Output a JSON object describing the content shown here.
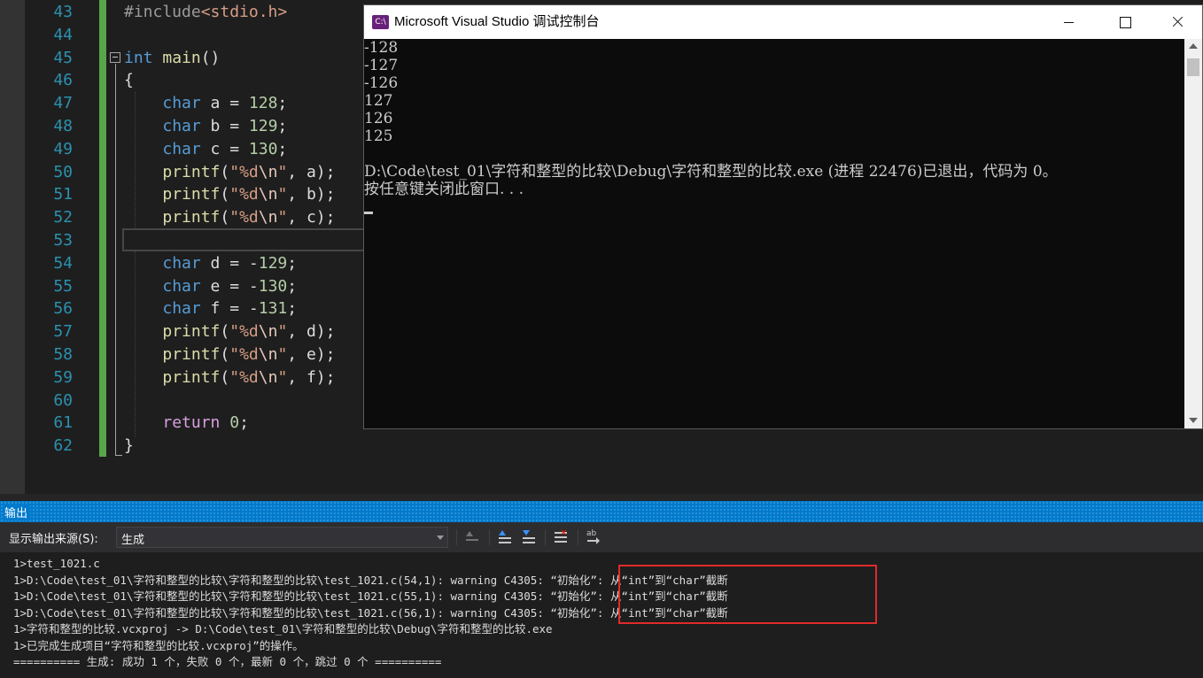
{
  "editor": {
    "lines": [
      {
        "n": "43",
        "segs": [
          [
            "pp",
            "#include"
          ],
          [
            "inc",
            "<stdio.h>"
          ]
        ]
      },
      {
        "n": "44",
        "segs": []
      },
      {
        "n": "45",
        "segs": [
          [
            "kw",
            "int"
          ],
          [
            "",
            " "
          ],
          [
            "fn",
            "main"
          ],
          [
            "",
            "()"
          ]
        ]
      },
      {
        "n": "46",
        "segs": [
          [
            "",
            "{"
          ]
        ]
      },
      {
        "n": "47",
        "segs": [
          [
            "",
            "    "
          ],
          [
            "kw",
            "char"
          ],
          [
            "",
            " a = "
          ],
          [
            "num",
            "128"
          ],
          [
            "",
            ";"
          ]
        ]
      },
      {
        "n": "48",
        "segs": [
          [
            "",
            "    "
          ],
          [
            "kw",
            "char"
          ],
          [
            "",
            " b = "
          ],
          [
            "num",
            "129"
          ],
          [
            "",
            ";"
          ]
        ]
      },
      {
        "n": "49",
        "segs": [
          [
            "",
            "    "
          ],
          [
            "kw",
            "char"
          ],
          [
            "",
            " c = "
          ],
          [
            "num",
            "130"
          ],
          [
            "",
            ";"
          ]
        ]
      },
      {
        "n": "50",
        "segs": [
          [
            "",
            "    "
          ],
          [
            "fn",
            "printf"
          ],
          [
            "",
            "("
          ],
          [
            "str",
            "\"%d"
          ],
          [
            "esc",
            "\\n"
          ],
          [
            "str",
            "\""
          ],
          [
            "",
            ", a);"
          ]
        ]
      },
      {
        "n": "51",
        "segs": [
          [
            "",
            "    "
          ],
          [
            "fn",
            "printf"
          ],
          [
            "",
            "("
          ],
          [
            "str",
            "\"%d"
          ],
          [
            "esc",
            "\\n"
          ],
          [
            "str",
            "\""
          ],
          [
            "",
            ", b);"
          ]
        ]
      },
      {
        "n": "52",
        "segs": [
          [
            "",
            "    "
          ],
          [
            "fn",
            "printf"
          ],
          [
            "",
            "("
          ],
          [
            "str",
            "\"%d"
          ],
          [
            "esc",
            "\\n"
          ],
          [
            "str",
            "\""
          ],
          [
            "",
            ", c);"
          ]
        ]
      },
      {
        "n": "53",
        "segs": []
      },
      {
        "n": "54",
        "segs": [
          [
            "",
            "    "
          ],
          [
            "kw",
            "char"
          ],
          [
            "",
            " d = -"
          ],
          [
            "num",
            "129"
          ],
          [
            "",
            ";"
          ]
        ]
      },
      {
        "n": "55",
        "segs": [
          [
            "",
            "    "
          ],
          [
            "kw",
            "char"
          ],
          [
            "",
            " e = -"
          ],
          [
            "num",
            "130"
          ],
          [
            "",
            ";"
          ]
        ]
      },
      {
        "n": "56",
        "segs": [
          [
            "",
            "    "
          ],
          [
            "kw",
            "char"
          ],
          [
            "",
            " f = -"
          ],
          [
            "num",
            "131"
          ],
          [
            "",
            ";"
          ]
        ]
      },
      {
        "n": "57",
        "segs": [
          [
            "",
            "    "
          ],
          [
            "fn",
            "printf"
          ],
          [
            "",
            "("
          ],
          [
            "str",
            "\"%d"
          ],
          [
            "esc",
            "\\n"
          ],
          [
            "str",
            "\""
          ],
          [
            "",
            ", d);"
          ]
        ]
      },
      {
        "n": "58",
        "segs": [
          [
            "",
            "    "
          ],
          [
            "fn",
            "printf"
          ],
          [
            "",
            "("
          ],
          [
            "str",
            "\"%d"
          ],
          [
            "esc",
            "\\n"
          ],
          [
            "str",
            "\""
          ],
          [
            "",
            ", e);"
          ]
        ]
      },
      {
        "n": "59",
        "segs": [
          [
            "",
            "    "
          ],
          [
            "fn",
            "printf"
          ],
          [
            "",
            "("
          ],
          [
            "str",
            "\"%d"
          ],
          [
            "esc",
            "\\n"
          ],
          [
            "str",
            "\""
          ],
          [
            "",
            ", f);"
          ]
        ]
      },
      {
        "n": "60",
        "segs": []
      },
      {
        "n": "61",
        "segs": [
          [
            "",
            "    "
          ],
          [
            "kw2",
            "return"
          ],
          [
            "",
            " "
          ],
          [
            "num",
            "0"
          ],
          [
            "",
            ";"
          ]
        ]
      },
      {
        "n": "62",
        "segs": [
          [
            "",
            "}"
          ]
        ]
      }
    ]
  },
  "console": {
    "title": "Microsoft Visual Studio 调试控制台",
    "icon_text": "C:\\",
    "output": [
      "-128",
      "-127",
      "-126",
      "127",
      "126",
      "125",
      "",
      "D:\\Code\\test_01\\字符和整型的比较\\Debug\\字符和整型的比较.exe (进程 22476)已退出，代码为 0。",
      "按任意键关闭此窗口. . ."
    ]
  },
  "output_panel": {
    "title": "输出",
    "source_label": "显示输出来源(S):",
    "source_value": "生成",
    "lines": [
      "1>test_1021.c",
      "1>D:\\Code\\test_01\\字符和整型的比较\\字符和整型的比较\\test_1021.c(54,1): warning C4305: “初始化”: 从“int”到“char”截断",
      "1>D:\\Code\\test_01\\字符和整型的比较\\字符和整型的比较\\test_1021.c(55,1): warning C4305: “初始化”: 从“int”到“char”截断",
      "1>D:\\Code\\test_01\\字符和整型的比较\\字符和整型的比较\\test_1021.c(56,1): warning C4305: “初始化”: 从“int”到“char”截断",
      "1>字符和整型的比较.vcxproj -> D:\\Code\\test_01\\字符和整型的比较\\Debug\\字符和整型的比较.exe",
      "1>已完成生成项目“字符和整型的比较.vcxproj”的操作。",
      "========== 生成: 成功 1 个，失败 0 个，最新 0 个，跳过 0 个 =========="
    ]
  },
  "colors": {
    "editor_bg": "#1e1e1e",
    "keyword": "#569cd6",
    "function": "#dcdcaa",
    "string": "#d69d85",
    "number": "#b5cea8",
    "line_number": "#2b91af",
    "change_bar": "#57a64a",
    "output_header": "#007acc",
    "highlight_box": "#e12a2a"
  }
}
